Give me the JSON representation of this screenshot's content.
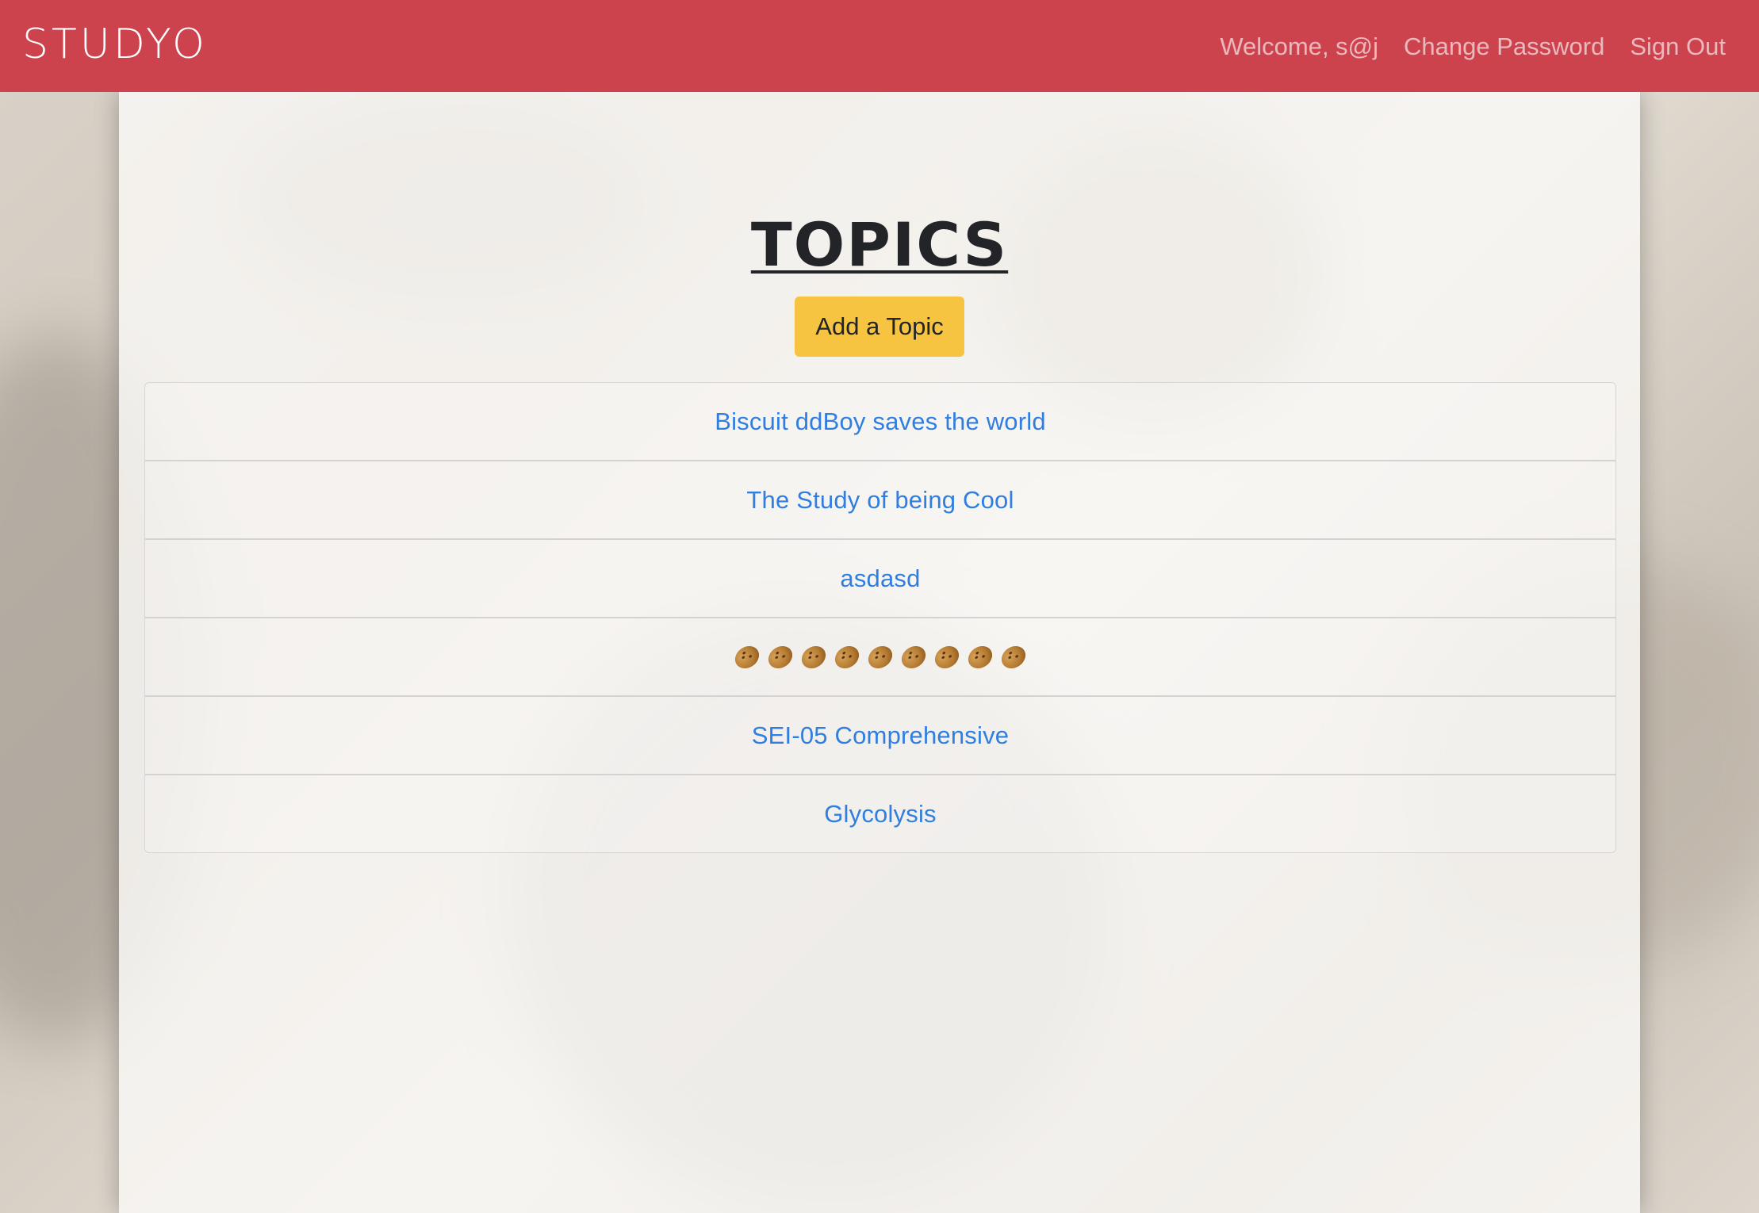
{
  "navbar": {
    "brand": "STUDYO",
    "links": [
      {
        "label": "Welcome, s@j"
      },
      {
        "label": "Change Password"
      },
      {
        "label": "Sign Out"
      }
    ]
  },
  "main": {
    "title": "TOPICS",
    "add_button_label": "Add a Topic",
    "topics": [
      {
        "label": "Biscuit ddBoy saves the world"
      },
      {
        "label": "The Study of being Cool"
      },
      {
        "label": "asdasd"
      },
      {
        "label": "",
        "icon": "potato-emoji",
        "icon_count": 9
      },
      {
        "label": "SEI-05 Comprehensive"
      },
      {
        "label": "Glycolysis"
      }
    ]
  },
  "colors": {
    "navbar_bg": "#cd434d",
    "button_bg": "#f7c441",
    "link": "#2f7ee0"
  }
}
